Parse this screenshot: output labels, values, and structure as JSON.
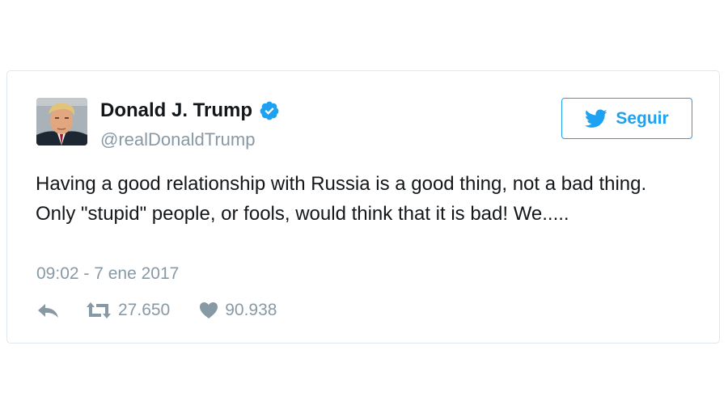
{
  "tweet": {
    "author_name": "Donald J. Trump",
    "author_handle": "@realDonaldTrump",
    "verified": true,
    "text": "Having a good relationship with Russia is a good thing, not a bad thing. Only \"stupid\" people, or fools, would think that it is bad! We.....",
    "timestamp": "09:02 - 7 ene 2017",
    "retweets": "27.650",
    "likes": "90.938"
  },
  "follow_button": {
    "label": "Seguir",
    "icon": "twitter-bird-icon"
  },
  "colors": {
    "accent": "#1da1f2",
    "verified": "#1da1f2",
    "text_primary": "#14171a",
    "text_secondary": "#8899a6",
    "border": "#e1e8ed"
  },
  "icons": {
    "reply": "reply-icon",
    "retweet": "retweet-icon",
    "like": "heart-icon",
    "verified": "verified-badge-icon"
  }
}
